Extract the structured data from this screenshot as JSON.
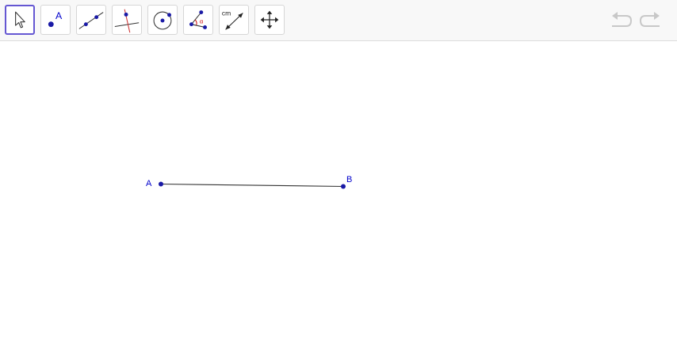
{
  "toolbar": {
    "tools": [
      {
        "name": "move-tool",
        "icon": "cursor-arrow-icon",
        "selected": true
      },
      {
        "name": "point-tool",
        "icon": "point-icon",
        "label": "A"
      },
      {
        "name": "line-tool",
        "icon": "line-through-points-icon"
      },
      {
        "name": "perpendicular-line-tool",
        "icon": "perpendicular-line-icon"
      },
      {
        "name": "circle-tool",
        "icon": "circle-center-point-icon"
      },
      {
        "name": "angle-tool",
        "icon": "angle-icon",
        "label": "α"
      },
      {
        "name": "distance-tool",
        "icon": "distance-length-icon",
        "label": "cm"
      },
      {
        "name": "move-graphics-view-tool",
        "icon": "move-arrows-icon"
      }
    ],
    "undo_icon": "undo-icon",
    "redo_icon": "redo-icon"
  },
  "construction": {
    "points": [
      {
        "label": "A"
      },
      {
        "label": "B"
      }
    ],
    "segment": {
      "from": "A",
      "to": "B"
    }
  },
  "colors": {
    "accent": "#6557d2",
    "point": "#1a1aa6",
    "point_label": "#0000cc",
    "segment": "#333333",
    "angle_red": "#cc0000",
    "disabled_icon": "#c8c8c8"
  }
}
